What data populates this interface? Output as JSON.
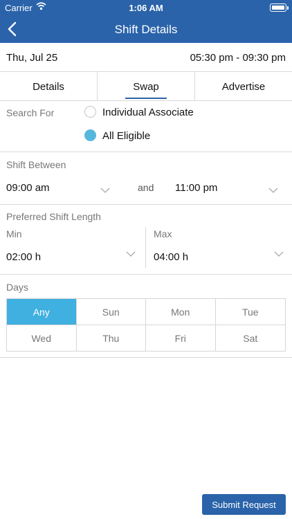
{
  "status_bar": {
    "carrier": "Carrier",
    "time": "1:06 AM"
  },
  "nav": {
    "title": "Shift Details",
    "back_icon": "chevron-left-icon"
  },
  "shift": {
    "date": "Thu, Jul 25",
    "time_range": "05:30 pm - 09:30 pm"
  },
  "tabs": [
    {
      "label": "Details",
      "active": false
    },
    {
      "label": "Swap",
      "active": true
    },
    {
      "label": "Advertise",
      "active": false
    }
  ],
  "search_for": {
    "label": "Search For",
    "options": [
      {
        "label": "Individual Associate",
        "checked": false
      },
      {
        "label": "All Eligible",
        "checked": true
      }
    ]
  },
  "shift_between": {
    "label": "Shift Between",
    "from": "09:00 am",
    "and": "and",
    "to": "11:00 pm"
  },
  "preferred_length": {
    "label": "Preferred Shift Length",
    "min_label": "Min",
    "min_value": "02:00 h",
    "max_label": "Max",
    "max_value": "04:00 h"
  },
  "days": {
    "label": "Days",
    "items": [
      "Any",
      "Sun",
      "Mon",
      "Tue",
      "Wed",
      "Thu",
      "Fri",
      "Sat"
    ],
    "selected": "Any"
  },
  "submit_label": "Submit Request",
  "colors": {
    "primary": "#2a63a9",
    "accent": "#3fb0df",
    "radio_checked": "#56b7dd"
  }
}
